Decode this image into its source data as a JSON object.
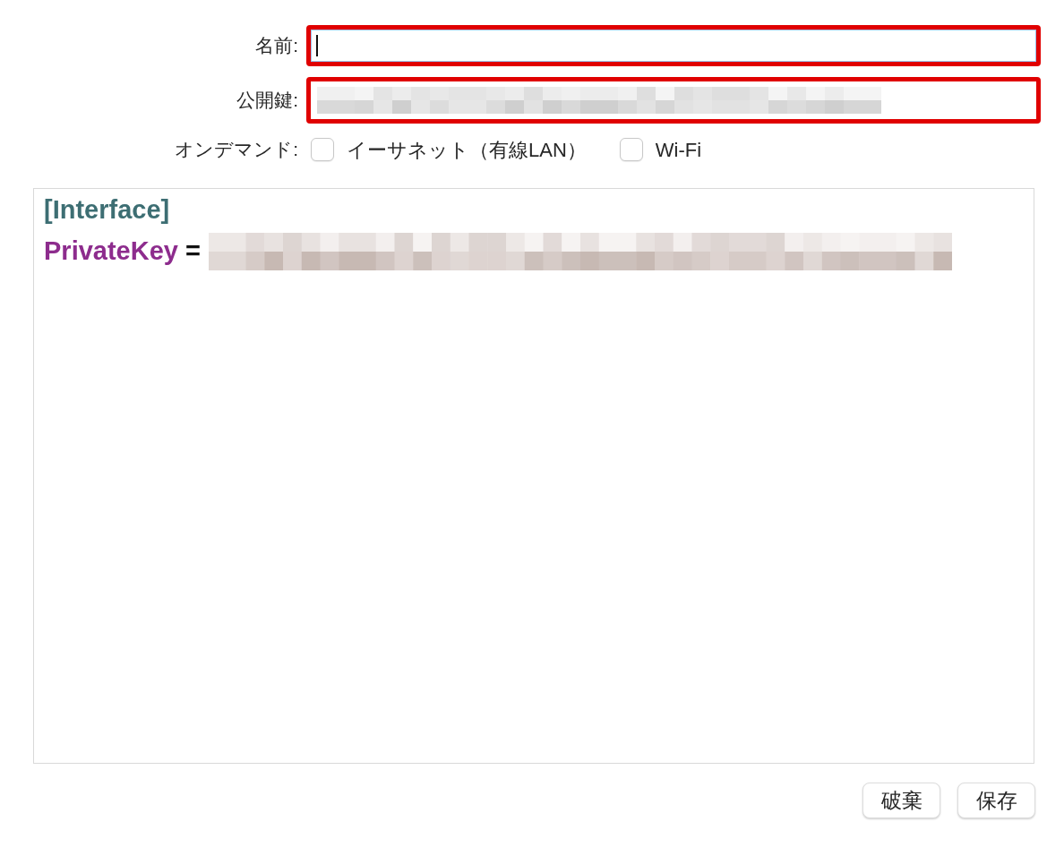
{
  "form": {
    "fields": [
      {
        "label": "名前:",
        "kind": "text",
        "focused": true,
        "highlighted": true
      },
      {
        "label": "公開鍵:",
        "kind": "redacted",
        "highlighted": true
      }
    ],
    "on_demand": {
      "label": "オンデマンド:",
      "options": [
        {
          "label": "イーサネット（有線LAN）",
          "checked": false
        },
        {
          "label": "Wi-Fi",
          "checked": false
        }
      ]
    }
  },
  "editor": {
    "lines": [
      {
        "kind": "section",
        "text": "[Interface]"
      },
      {
        "kind": "pair",
        "key": "PrivateKey",
        "operator": "=",
        "value_redacted": true
      }
    ]
  },
  "buttons": [
    {
      "label": "破棄"
    },
    {
      "label": "保存"
    }
  ]
}
